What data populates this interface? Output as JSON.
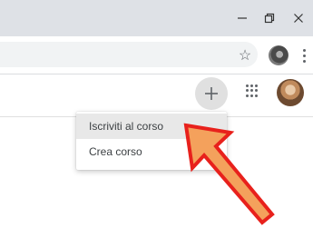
{
  "window_controls": {
    "minimize_icon": "minimize-icon",
    "restore_icon": "restore-icon",
    "close_icon": "close-icon"
  },
  "toolbar": {
    "bookmark_icon": "star-icon",
    "menu_icon": "kebab-menu-icon"
  },
  "app_header": {
    "add_icon": "plus-icon",
    "apps_icon": "apps-grid-icon"
  },
  "create_menu": {
    "items": [
      {
        "label": "Iscriviti al corso",
        "highlighted": true
      },
      {
        "label": "Crea corso",
        "highlighted": false
      }
    ]
  },
  "annotation": {
    "arrow_fill": "#f4a15c",
    "arrow_stroke": "#e8211c"
  }
}
